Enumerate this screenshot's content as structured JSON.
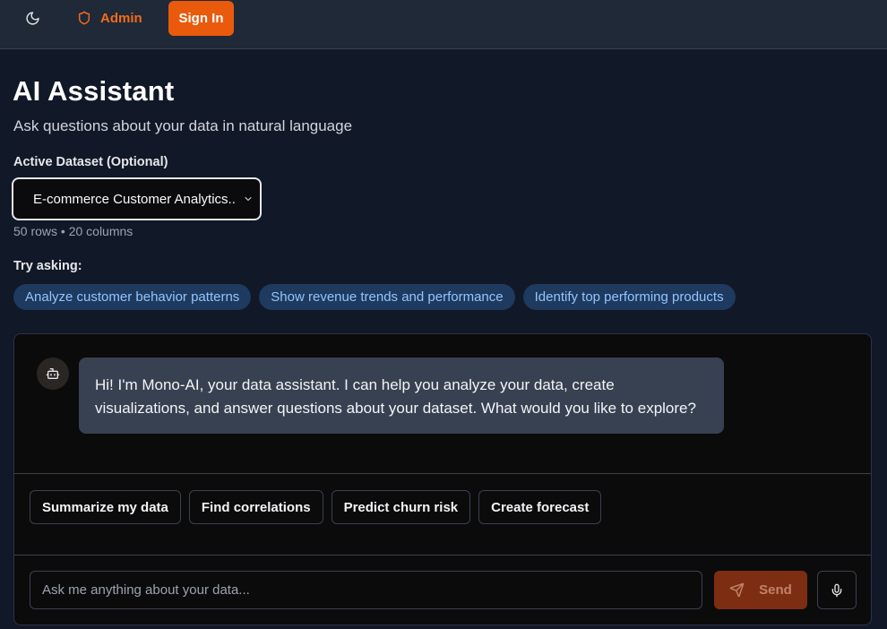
{
  "topbar": {
    "theme_icon": "moon-icon",
    "admin_icon": "shield-icon",
    "admin_label": "Admin",
    "signin_label": "Sign In",
    "accent": "#ea5a0c"
  },
  "header": {
    "title": "AI Assistant",
    "subtitle": "Ask questions about your data in natural language"
  },
  "dataset": {
    "label": "Active Dataset (Optional)",
    "selected": "E-commerce Customer Analytics..",
    "meta": "50 rows • 20 columns"
  },
  "suggestions": {
    "label": "Try asking:",
    "items": [
      "Analyze customer behavior patterns",
      "Show revenue trends and performance",
      "Identify top performing products"
    ]
  },
  "chat": {
    "bot_icon": "bot-icon",
    "messages": [
      {
        "role": "assistant",
        "text": "Hi! I'm Mono-AI, your data assistant. I can help you analyze your data, create visualizations, and answer questions about your dataset. What would you like to explore?"
      }
    ],
    "quick_actions": [
      "Summarize my data",
      "Find correlations",
      "Predict churn risk",
      "Create forecast"
    ],
    "input_placeholder": "Ask me anything about your data...",
    "input_value": "",
    "send_label": "Send",
    "send_icon": "send-icon",
    "mic_icon": "mic-icon"
  }
}
